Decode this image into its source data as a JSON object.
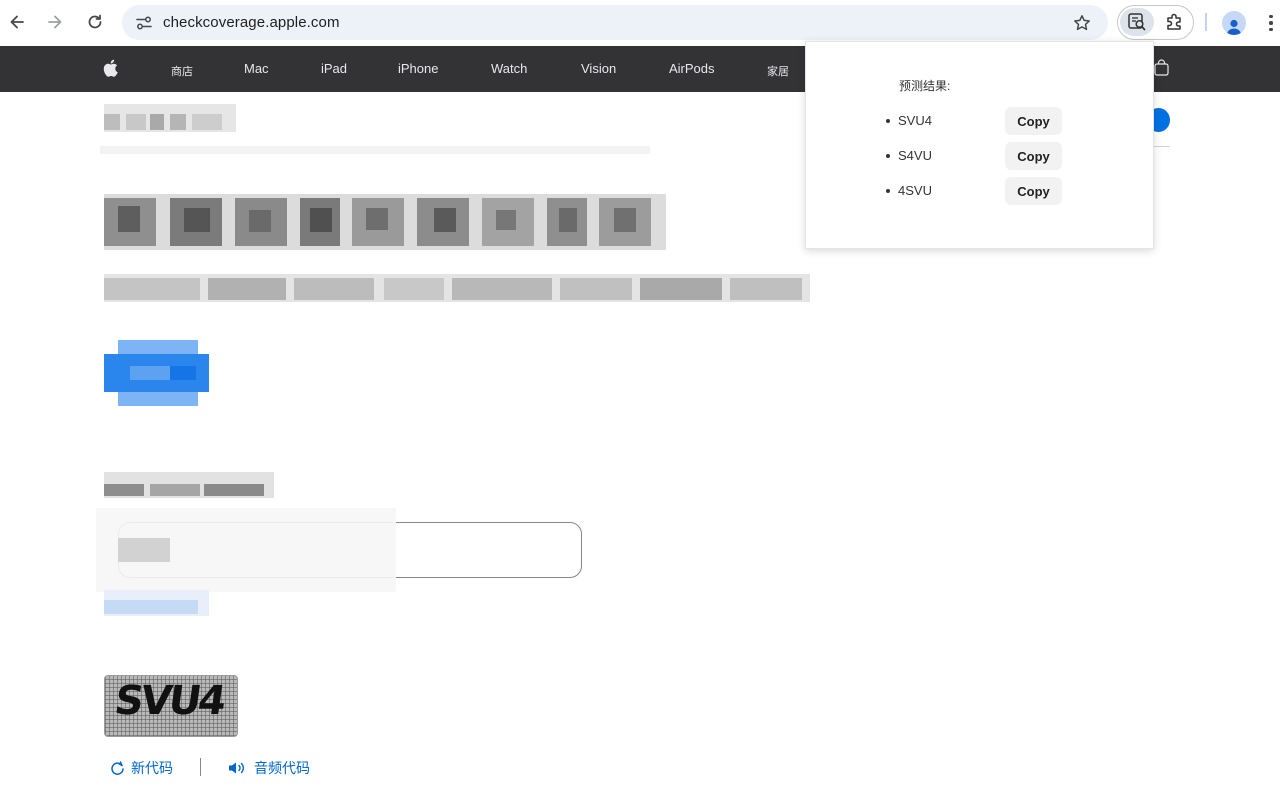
{
  "browser": {
    "url": "checkcoverage.apple.com",
    "icons": {
      "back": "arrow-left-icon",
      "forward": "arrow-right-icon",
      "reload": "reload-icon",
      "site_info": "tune-icon",
      "bookmark": "star-icon",
      "extension_active": "captcha-solver-extension-icon",
      "extensions": "puzzle-icon",
      "profile": "profile-avatar-icon",
      "menu": "kebab-menu-icon"
    }
  },
  "apple_nav": {
    "items": [
      "商店",
      "Mac",
      "iPad",
      "iPhone",
      "Watch",
      "Vision",
      "AirPods",
      "家居"
    ],
    "icons": {
      "logo": "apple-logo-icon",
      "bag": "shopping-bag-icon"
    },
    "colors": {
      "background": "#333336",
      "text": "#e8e8ed"
    }
  },
  "captcha": {
    "image_text": "SVU4",
    "links": {
      "new_code": "新代码",
      "audio_code": "音频代码"
    },
    "link_color": "#0066cc"
  },
  "popup": {
    "title": "预测结果:",
    "results": [
      {
        "code": "SVU4",
        "button": "Copy"
      },
      {
        "code": "S4VU",
        "button": "Copy"
      },
      {
        "code": "4SVU",
        "button": "Copy"
      }
    ]
  },
  "colors": {
    "accent": "#0071e3",
    "omnibox_bg": "#edf1f8"
  }
}
